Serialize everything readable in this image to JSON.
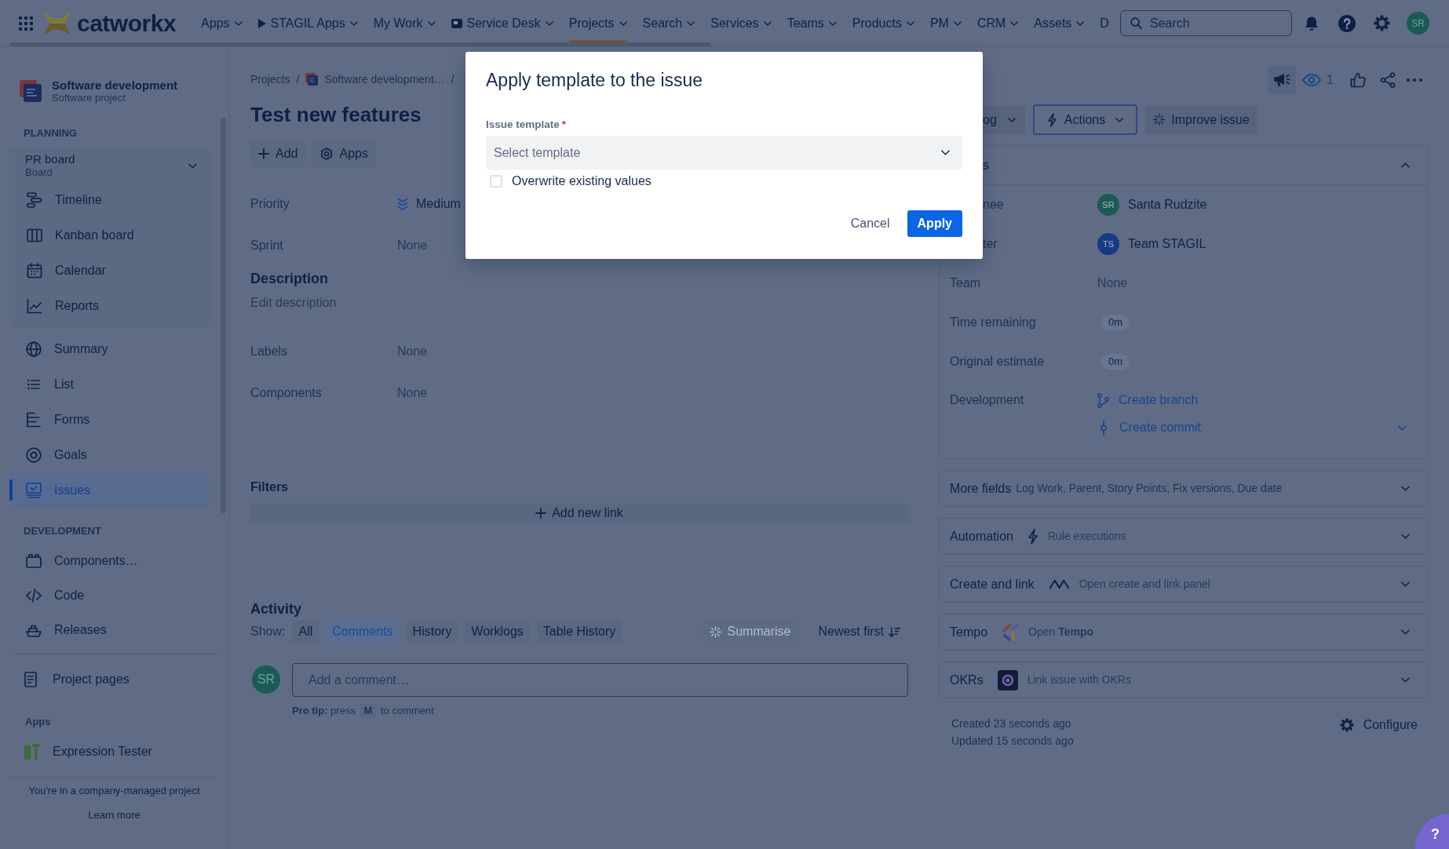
{
  "top_nav": {
    "logo": "catworkx",
    "items": [
      {
        "label": "Apps",
        "kind": "menu",
        "selected": false
      },
      {
        "label": "STAGIL Apps",
        "kind": "play_menu",
        "selected": false
      },
      {
        "label": "My Work",
        "kind": "menu",
        "selected": false
      },
      {
        "label": "Service Desk",
        "kind": "desk_menu",
        "selected": false
      },
      {
        "label": "Projects",
        "kind": "menu",
        "selected": true
      },
      {
        "label": "Search",
        "kind": "menu",
        "selected": false
      },
      {
        "label": "Services",
        "kind": "menu",
        "selected": false
      },
      {
        "label": "Teams",
        "kind": "menu",
        "selected": false
      },
      {
        "label": "Products",
        "kind": "menu",
        "selected": false
      },
      {
        "label": "PM",
        "kind": "menu",
        "selected": false
      },
      {
        "label": "CRM",
        "kind": "menu",
        "selected": false
      },
      {
        "label": "Assets",
        "kind": "menu",
        "selected": false
      },
      {
        "label": "D",
        "kind": "plain",
        "selected": false
      }
    ],
    "search": {
      "placeholder": "Search"
    },
    "avatar": "SR"
  },
  "sidebar": {
    "project": {
      "name": "Software development",
      "subtitle": "Software project"
    },
    "planning": {
      "heading": "PLANNING",
      "board": {
        "label": "PR board",
        "sublabel": "Board",
        "expanded": true,
        "items": [
          {
            "label": "Timeline",
            "selected": false
          },
          {
            "label": "Kanban board",
            "selected": false
          },
          {
            "label": "Calendar",
            "selected": false
          },
          {
            "label": "Reports",
            "selected": false
          }
        ]
      },
      "items": [
        {
          "label": "Summary",
          "selected": false
        },
        {
          "label": "List",
          "selected": false
        },
        {
          "label": "Forms",
          "selected": false
        },
        {
          "label": "Goals",
          "selected": false
        },
        {
          "label": "Issues",
          "selected": true
        }
      ]
    },
    "development": {
      "heading": "DEVELOPMENT",
      "items": [
        {
          "label": "Components…",
          "selected": false
        },
        {
          "label": "Code",
          "selected": false
        },
        {
          "label": "Releases",
          "selected": false
        }
      ]
    },
    "project_pages": {
      "label": "Project pages",
      "selected": false
    },
    "apps": {
      "heading": "Apps",
      "items": [
        {
          "label": "Expression Tester",
          "selected": false
        }
      ]
    },
    "footer": {
      "text": "You're in a company-managed project",
      "link": "Learn more"
    }
  },
  "breadcrumbs": {
    "separator": "/",
    "items": [
      {
        "label": "Projects",
        "kind": "text"
      },
      {
        "label": "Software development…",
        "kind": "project"
      }
    ]
  },
  "issue": {
    "title": "Test new features",
    "actions": [
      {
        "label": "Add",
        "kind": "add"
      },
      {
        "label": "Apps",
        "kind": "apps"
      }
    ],
    "fields": [
      {
        "label": "Priority",
        "value": "Medium",
        "kind": "priority"
      },
      {
        "label": "Sprint",
        "value": "None",
        "kind": "text"
      }
    ],
    "description": {
      "heading": "Description",
      "prompt": "Edit description"
    },
    "extra_fields": [
      {
        "label": "Labels",
        "value": "None",
        "kind": "text"
      },
      {
        "label": "Components",
        "value": "None",
        "kind": "text"
      }
    ],
    "links": {
      "heading": "Filters",
      "add_label": "Add new link"
    },
    "activity": {
      "heading": "Activity",
      "show_label": "Show:",
      "filters": [
        {
          "label": "All",
          "selected": false
        },
        {
          "label": "Comments",
          "selected": true
        },
        {
          "label": "History",
          "selected": false
        },
        {
          "label": "Worklogs",
          "selected": false
        },
        {
          "label": "Table History",
          "selected": false
        }
      ],
      "summarise": {
        "label": "Summarise",
        "disabled": true
      },
      "sort": {
        "label": "Newest first"
      },
      "comment": {
        "avatar": "SR",
        "placeholder": "Add a comment…",
        "tip": "**Pro tip:** press",
        "key": "M",
        "tip_end": "to comment"
      }
    }
  },
  "side": {
    "watchers": "1",
    "status": {
      "label": "og"
    },
    "actions": {
      "label": "Actions"
    },
    "improve": {
      "label": "Improve issue"
    },
    "details": {
      "title": "s",
      "clipped": true,
      "expanded": true,
      "rows": [
        {
          "label": "nee",
          "clipped": true,
          "kind": "user",
          "value": "Santa Rudzite",
          "avatar": "SR",
          "color": "#1b5a55"
        },
        {
          "label": "ter",
          "clipped": true,
          "kind": "user",
          "value": "Team STAGIL",
          "avatar": "TS",
          "color": "#163b85"
        },
        {
          "label": "Team",
          "kind": "text",
          "value": "None"
        },
        {
          "label": "Time remaining",
          "kind": "badge",
          "value": "0m"
        },
        {
          "label": "Original estimate",
          "kind": "badge",
          "value": "0m"
        },
        {
          "label": "Development",
          "kind": "links",
          "expanded": false,
          "links": [
            {
              "label": "Create branch"
            },
            {
              "label": "Create commit"
            }
          ]
        }
      ]
    },
    "panels": [
      {
        "title": "More fields",
        "kind": "fields",
        "summary": "Log Work, Parent, Story Points, Fix versions, Due date",
        "expanded": false
      },
      {
        "title": "Automation",
        "kind": "app",
        "summary": "Rule executions",
        "expanded": false
      },
      {
        "title": "Create and link",
        "kind": "app",
        "summary": "Open create and link panel",
        "expanded": false
      },
      {
        "title": "Tempo",
        "kind": "app",
        "summary": "Open **Tempo**",
        "expanded": false
      },
      {
        "title": "OKRs",
        "kind": "app",
        "summary": "Link issue with OKRs",
        "expanded": false
      }
    ],
    "created": "Created 23 seconds ago",
    "updated": "Updated 15 seconds ago",
    "configure": "Configure"
  },
  "modal": {
    "title": "Apply template to the issue",
    "field": {
      "label": "Issue template",
      "required": true,
      "required_mark": "*",
      "placeholder": "Select template"
    },
    "checkbox": {
      "label": "Overwrite existing values",
      "checked": false
    },
    "buttons": [
      {
        "label": "Cancel",
        "kind": "cancel"
      },
      {
        "label": "Apply",
        "kind": "apply"
      }
    ]
  },
  "help_button": {
    "label": "?"
  }
}
